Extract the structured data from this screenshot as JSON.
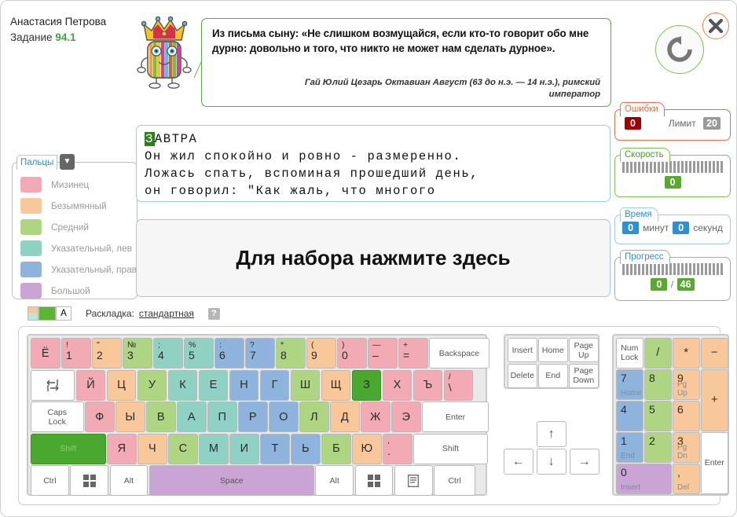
{
  "header": {
    "user_name": "Анастасия Петрова",
    "task_label": "Задание",
    "task_number": "94.1",
    "restart_icon": "refresh-icon",
    "close_icon": "close-icon",
    "mascot_icon": "king-mascot-icon"
  },
  "quote": {
    "text": "Из письма сыну: «Не слишком возмущайся, если кто-то говорит обо мне дурно: довольно и того, что никто не может нам сделать дурное».",
    "author": "Гай Юлий Цезарь Октавиан Август (63 до н.э. — 14 н.э.), римский император"
  },
  "stats": {
    "errors": {
      "title": "Ошибки",
      "value": "0",
      "limit_label": "Лимит",
      "limit_value": "20"
    },
    "speed": {
      "title": "Скорость",
      "value": "0"
    },
    "time": {
      "title": "Время",
      "minutes": "0",
      "minutes_label": "минут",
      "seconds": "0",
      "seconds_label": "секунд"
    },
    "progress": {
      "title": "Прогресс",
      "current": "0",
      "separator": "/",
      "total": "46"
    }
  },
  "fingers": {
    "title": "Пальцы",
    "chevron_icon": "chevron-down-icon",
    "items": [
      {
        "label": "Мизинец",
        "color": "#f2aab4"
      },
      {
        "label": "Безымянный",
        "color": "#f8c89a"
      },
      {
        "label": "Средний",
        "color": "#aed581"
      },
      {
        "label": "Указательный, лев",
        "color": "#8fd2c4"
      },
      {
        "label": "Указательный, прав",
        "color": "#8eb4dd"
      },
      {
        "label": "Большой",
        "color": "#c9a4d4"
      }
    ]
  },
  "text_display": {
    "cursor_char": "З",
    "line1_rest": "АВТРА",
    "line2": "Он жил спокойно и ровно - размеренно.",
    "line3": "Ложась спать, вспоминая прошедший день,",
    "line4": "он говорил: \"Как жаль, что многого"
  },
  "input_prompt": {
    "text": "Для набора нажмите здесь"
  },
  "layout_bar": {
    "label": "Раскладка:",
    "value": "стандартная",
    "letter_button": "A",
    "help": "?"
  },
  "keyboard": {
    "row1": [
      {
        "name": "key-yo",
        "main": "Ё",
        "color": "#f2aab4"
      },
      {
        "name": "key-1",
        "top": "!",
        "bot": "1",
        "color": "#f2aab4"
      },
      {
        "name": "key-2",
        "top": "\"",
        "bot": "2",
        "color": "#f8c89a"
      },
      {
        "name": "key-3",
        "top": "№",
        "bot": "3",
        "color": "#aed581"
      },
      {
        "name": "key-4",
        "top": ";",
        "bot": "4",
        "color": "#8fd2c4"
      },
      {
        "name": "key-5",
        "top": "%",
        "bot": "5",
        "color": "#8fd2c4"
      },
      {
        "name": "key-6",
        "top": ":",
        "bot": "6",
        "color": "#8eb4dd"
      },
      {
        "name": "key-7",
        "top": "?",
        "bot": "7",
        "color": "#8eb4dd"
      },
      {
        "name": "key-8",
        "top": "*",
        "bot": "8",
        "color": "#aed581"
      },
      {
        "name": "key-9",
        "top": "(",
        "bot": "9",
        "color": "#f8c89a"
      },
      {
        "name": "key-0",
        "top": ")",
        "bot": "0",
        "color": "#f2aab4"
      },
      {
        "name": "key-minus",
        "top": "—",
        "bot": "–",
        "color": "#f2aab4"
      },
      {
        "name": "key-equals",
        "top": "+",
        "bot": "=",
        "color": "#f2aab4"
      },
      {
        "name": "key-backspace",
        "main": "Backspace",
        "sys": true,
        "color": "#ffffff"
      }
    ],
    "row2": [
      {
        "name": "key-tab",
        "main": "",
        "icon": "tab-icon",
        "sys": true,
        "color": "#ffffff"
      },
      {
        "name": "key-i-short",
        "main": "Й",
        "color": "#f2aab4"
      },
      {
        "name": "key-tse",
        "main": "Ц",
        "color": "#f8c89a"
      },
      {
        "name": "key-u",
        "main": "У",
        "color": "#aed581"
      },
      {
        "name": "key-ka",
        "main": "К",
        "color": "#8fd2c4"
      },
      {
        "name": "key-ie",
        "main": "Е",
        "color": "#8fd2c4"
      },
      {
        "name": "key-en",
        "main": "Н",
        "color": "#8eb4dd"
      },
      {
        "name": "key-ghe",
        "main": "Г",
        "color": "#8eb4dd"
      },
      {
        "name": "key-sha",
        "main": "Ш",
        "color": "#aed581"
      },
      {
        "name": "key-shcha",
        "main": "Щ",
        "color": "#f8c89a"
      },
      {
        "name": "key-ze",
        "main": "З",
        "color": "#f2aab4",
        "active": true
      },
      {
        "name": "key-ha",
        "main": "Х",
        "color": "#f2aab4"
      },
      {
        "name": "key-hard-sign",
        "main": "Ъ",
        "color": "#f2aab4"
      },
      {
        "name": "key-slash",
        "top": "/",
        "bot": "\\",
        "color": "#f2aab4"
      }
    ],
    "row3": [
      {
        "name": "key-caps-lock",
        "main": "Caps Lock",
        "sys": true,
        "color": "#ffffff"
      },
      {
        "name": "key-ef",
        "main": "Ф",
        "color": "#f2aab4"
      },
      {
        "name": "key-yery",
        "main": "Ы",
        "color": "#f8c89a"
      },
      {
        "name": "key-ve",
        "main": "В",
        "color": "#aed581"
      },
      {
        "name": "key-a",
        "main": "А",
        "color": "#8fd2c4"
      },
      {
        "name": "key-pe",
        "main": "П",
        "color": "#8fd2c4"
      },
      {
        "name": "key-er",
        "main": "Р",
        "color": "#8eb4dd"
      },
      {
        "name": "key-o",
        "main": "О",
        "color": "#8eb4dd"
      },
      {
        "name": "key-el",
        "main": "Л",
        "color": "#aed581"
      },
      {
        "name": "key-de",
        "main": "Д",
        "color": "#f8c89a"
      },
      {
        "name": "key-zhe",
        "main": "Ж",
        "color": "#f2aab4"
      },
      {
        "name": "key-e-reversed",
        "main": "Э",
        "color": "#f2aab4"
      },
      {
        "name": "key-enter",
        "main": "Enter",
        "sys": true,
        "color": "#ffffff"
      }
    ],
    "row4": [
      {
        "name": "key-shift-left",
        "main": "Shift",
        "sys": true,
        "color": "#aed581",
        "active": true
      },
      {
        "name": "key-ya",
        "main": "Я",
        "color": "#f2aab4"
      },
      {
        "name": "key-che",
        "main": "Ч",
        "color": "#f8c89a"
      },
      {
        "name": "key-es",
        "main": "С",
        "color": "#aed581"
      },
      {
        "name": "key-em",
        "main": "М",
        "color": "#8fd2c4"
      },
      {
        "name": "key-i",
        "main": "И",
        "color": "#8fd2c4"
      },
      {
        "name": "key-te",
        "main": "Т",
        "color": "#8eb4dd"
      },
      {
        "name": "key-soft-sign",
        "main": "Ь",
        "color": "#8eb4dd"
      },
      {
        "name": "key-be",
        "main": "Б",
        "color": "#aed581"
      },
      {
        "name": "key-yu",
        "main": "Ю",
        "color": "#f8c89a"
      },
      {
        "name": "key-comma",
        "top": ",",
        "bot": ".",
        "color": "#f2aab4"
      },
      {
        "name": "key-shift-right",
        "main": "Shift",
        "sys": true,
        "color": "#ffffff"
      }
    ],
    "row5": [
      {
        "name": "key-ctrl-left",
        "main": "Ctrl",
        "sys": true,
        "color": "#ffffff"
      },
      {
        "name": "key-win-left",
        "main": "",
        "icon": "windows-icon",
        "sys": true,
        "color": "#ffffff"
      },
      {
        "name": "key-alt-left",
        "main": "Alt",
        "sys": true,
        "color": "#ffffff"
      },
      {
        "name": "key-space",
        "main": "Space",
        "sys": true,
        "color": "#c9a4d4"
      },
      {
        "name": "key-alt-right",
        "main": "Alt",
        "sys": true,
        "color": "#ffffff"
      },
      {
        "name": "key-win-right",
        "main": "",
        "icon": "windows-icon",
        "sys": true,
        "color": "#ffffff"
      },
      {
        "name": "key-menu",
        "main": "",
        "icon": "menu-icon",
        "sys": true,
        "color": "#ffffff"
      },
      {
        "name": "key-ctrl-right",
        "main": "Ctrl",
        "sys": true,
        "color": "#ffffff"
      }
    ],
    "nav_cluster": [
      {
        "name": "key-insert",
        "main": "Insert"
      },
      {
        "name": "key-home",
        "main": "Home"
      },
      {
        "name": "key-page-up",
        "main": "Page Up"
      },
      {
        "name": "key-delete",
        "main": "Delete"
      },
      {
        "name": "key-end",
        "main": "End"
      },
      {
        "name": "key-page-down",
        "main": "Page Down"
      }
    ],
    "arrows": [
      {
        "name": "key-arrow-up",
        "glyph": "↑"
      },
      {
        "name": "key-arrow-left",
        "glyph": "←"
      },
      {
        "name": "key-arrow-down",
        "glyph": "↓"
      },
      {
        "name": "key-arrow-right",
        "glyph": "→"
      }
    ],
    "numpad": [
      {
        "name": "key-num-lock",
        "main": "Num Lock",
        "sys": true,
        "color": "#ffffff"
      },
      {
        "name": "key-np-divide",
        "main": "/",
        "color": "#aed581"
      },
      {
        "name": "key-np-multiply",
        "main": "*",
        "color": "#f8c89a"
      },
      {
        "name": "key-np-minus",
        "main": "−",
        "color": "#f8c89a"
      },
      {
        "name": "key-np-7",
        "main": "7",
        "sub": "Home",
        "color": "#8eb4dd"
      },
      {
        "name": "key-np-8",
        "main": "8",
        "sub": "",
        "color": "#aed581"
      },
      {
        "name": "key-np-9",
        "main": "9",
        "sub": "Pg Up",
        "color": "#f8c89a"
      },
      {
        "name": "key-np-plus",
        "main": "+",
        "color": "#f8c89a"
      },
      {
        "name": "key-np-4",
        "main": "4",
        "sub": "",
        "color": "#8eb4dd"
      },
      {
        "name": "key-np-5",
        "main": "5",
        "sub": "",
        "color": "#aed581"
      },
      {
        "name": "key-np-6",
        "main": "6",
        "sub": "",
        "color": "#f8c89a"
      },
      {
        "name": "key-np-1",
        "main": "1",
        "sub": "End",
        "color": "#8eb4dd"
      },
      {
        "name": "key-np-2",
        "main": "2",
        "sub": "",
        "color": "#aed581"
      },
      {
        "name": "key-np-3",
        "main": "3",
        "sub": "Pg Dn",
        "color": "#f8c89a"
      },
      {
        "name": "key-np-enter",
        "main": "Enter",
        "sys": true,
        "color": "#ffffff"
      },
      {
        "name": "key-np-0",
        "main": "0",
        "sub": "Insert",
        "color": "#c9a4d4"
      },
      {
        "name": "key-np-decimal",
        "main": ",",
        "sub": "Del",
        "color": "#f8c89a"
      }
    ]
  }
}
